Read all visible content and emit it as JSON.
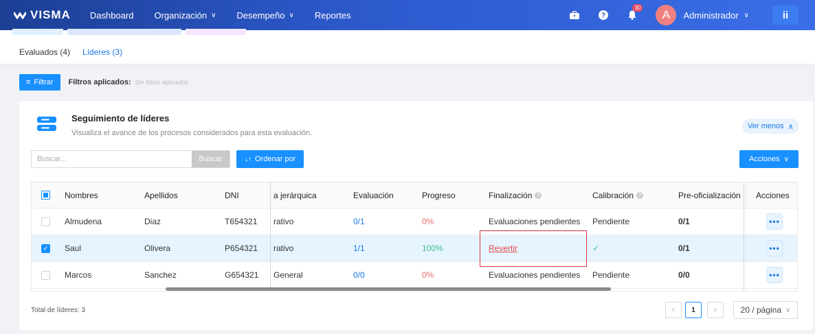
{
  "topbar": {
    "brand": "VISMA",
    "nav": [
      {
        "label": "Dashboard",
        "has_menu": false
      },
      {
        "label": "Organización",
        "has_menu": true
      },
      {
        "label": "Desempeño",
        "has_menu": true
      },
      {
        "label": "Reportes",
        "has_menu": false
      }
    ],
    "notification_count": "30",
    "avatar_letter": "A",
    "user_name": "Administrador",
    "apps_label": "ii"
  },
  "tabs": [
    {
      "label": "Evaluados (4)",
      "active": false
    },
    {
      "label": "Líderes (3)",
      "active": true
    }
  ],
  "filters": {
    "button_label": "Filtrar",
    "applied_label": "Filtros aplicados:",
    "applied_value": "Sin filtros aplicados"
  },
  "card": {
    "title": "Seguimiento de líderes",
    "subtitle": "Visualiza el avance de los procesos considerados para esta evaluación.",
    "toggle_label": "Ver menos",
    "search_placeholder": "Buscar...",
    "search_button": "Buscar",
    "order_button": "Ordenar por",
    "actions_button": "Acciones"
  },
  "table": {
    "headers": {
      "names": "Nombres",
      "surnames": "Apellidos",
      "dni": "DNI",
      "hierarchy": "a jerárquica",
      "evaluation": "Evaluación",
      "progress": "Progreso",
      "finalization": "Finalización",
      "calibration": "Calibración",
      "preofficial": "Pre-oficialización",
      "actions": "Acciones"
    },
    "rows": [
      {
        "selected": false,
        "name": "Almudena",
        "surname": "Diaz",
        "dni": "T654321",
        "hierarchy": "rativo",
        "evaluation": "0/1",
        "progress": "0%",
        "finalization": "Evaluaciones pendientes",
        "finalization_link": false,
        "calibration": "Pendiente",
        "preofficial": "0/1",
        "actions": "•••"
      },
      {
        "selected": true,
        "name": "Saul",
        "surname": "Olivera",
        "dni": "P654321",
        "hierarchy": "rativo",
        "evaluation": "1/1",
        "progress": "100%",
        "finalization": "Revertir",
        "finalization_link": true,
        "calibration": "✓",
        "preofficial": "0/1",
        "actions": "•••"
      },
      {
        "selected": false,
        "name": "Marcos",
        "surname": "Sanchez",
        "dni": "G654321",
        "hierarchy": "General",
        "evaluation": "0/0",
        "progress": "0%",
        "finalization": "Evaluaciones pendientes",
        "finalization_link": false,
        "calibration": "Pendiente",
        "preofficial": "0/0",
        "actions": "•••"
      }
    ]
  },
  "footer": {
    "total_label": "Total de líderes: 3",
    "current_page": "1",
    "page_size": "20 / página"
  },
  "colors": {
    "primary": "#1890ff",
    "header_gradient_start": "#1c3f94",
    "header_gradient_end": "#3a6ee8",
    "highlight_box": "#d9333f"
  }
}
